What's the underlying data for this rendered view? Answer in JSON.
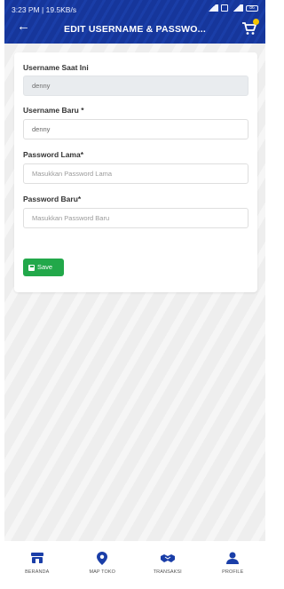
{
  "status_bar": {
    "time_speed": "3:23 PM | 19.5KB/s",
    "battery": "86"
  },
  "header": {
    "title": "EDIT USERNAME & PASSWO..."
  },
  "form": {
    "current_username_label": "Username Saat Ini",
    "current_username_value": "denny",
    "new_username_label": "Username Baru *",
    "new_username_value": "denny",
    "old_password_label": "Password Lama*",
    "old_password_placeholder": "Masukkan Password Lama",
    "new_password_label": "Password Baru*",
    "new_password_placeholder": "Masukkan Password Baru",
    "save_label": "Save"
  },
  "bottom_nav": {
    "items": [
      {
        "label": "BERANDA",
        "icon": "store-icon"
      },
      {
        "label": "MAP TOKO",
        "icon": "map-pin-icon"
      },
      {
        "label": "TRANSAKSI",
        "icon": "handshake-icon"
      },
      {
        "label": "PROFILE",
        "icon": "user-icon"
      }
    ]
  },
  "colors": {
    "primary": "#1a3ea8",
    "accent": "#f4c400",
    "save": "#22a84a"
  }
}
